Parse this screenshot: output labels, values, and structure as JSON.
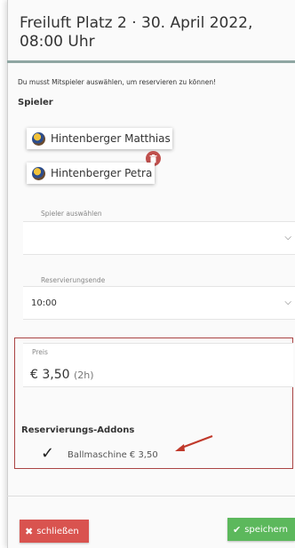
{
  "modal": {
    "title_line1": "Freiluft Platz 2 · 30. April 2022,",
    "title_line2": "08:00 Uhr",
    "hint": "Du musst Mitspieler auswählen, um reservieren zu können!"
  },
  "players": {
    "label": "Spieler",
    "items": [
      {
        "name": "Hintenberger Matthias"
      },
      {
        "name": "Hintenberger Petra"
      }
    ]
  },
  "player_select": {
    "label": "Spieler auswählen",
    "value": ""
  },
  "reservation_end": {
    "label": "Reservierungsende",
    "value": "10:00"
  },
  "price": {
    "label": "Preis",
    "value": "€ 3,50",
    "duration": "(2h)"
  },
  "addons": {
    "label": "Reservierungs-Addons",
    "items": [
      {
        "label": "Ballmaschine € 3,50",
        "checked": true
      }
    ]
  },
  "footer": {
    "close_label": "schließen",
    "save_label": "speichern"
  },
  "colors": {
    "danger": "#d9534f",
    "success": "#5cb85c",
    "highlight": "#aa4444",
    "accent_rule": "#8fa6a2"
  }
}
